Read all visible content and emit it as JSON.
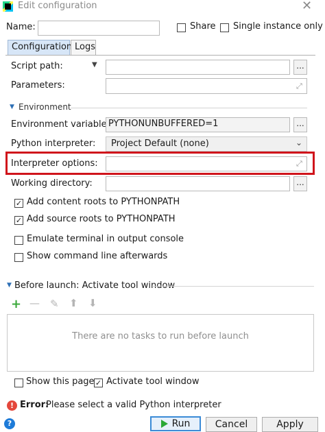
{
  "window": {
    "title": "Edit configuration"
  },
  "form": {
    "name_label": "Name:",
    "name_value": "",
    "share_label": "Share",
    "single_instance_label": "Single instance only"
  },
  "tabs": [
    {
      "label": "Configuration",
      "active": true
    },
    {
      "label": "Logs",
      "active": false
    }
  ],
  "config": {
    "script_path_label": "Script path:",
    "script_path_value": "",
    "parameters_label": "Parameters:",
    "parameters_value": "",
    "environment_header": "Environment",
    "env_vars_label": "Environment variables:",
    "env_vars_value": "PYTHONUNBUFFERED=1",
    "interpreter_label": "Python interpreter:",
    "interpreter_value": "Project Default (none)",
    "interpreter_options_label": "Interpreter options:",
    "interpreter_options_value": "",
    "working_dir_label": "Working directory:",
    "working_dir_value": "",
    "browse_label": "...",
    "checkboxes": [
      {
        "label": "Add content roots to PYTHONPATH",
        "checked": true
      },
      {
        "label": "Add source roots to PYTHONPATH",
        "checked": true
      },
      {
        "label": "Emulate terminal in output console",
        "checked": false
      },
      {
        "label": "Show command line afterwards",
        "checked": false
      }
    ]
  },
  "before_launch": {
    "header": "Before launch: Activate tool window",
    "empty_text": "There are no tasks to run before launch",
    "show_page_label": "Show this page",
    "show_page_checked": false,
    "activate_tool_label": "Activate tool window",
    "activate_tool_checked": true
  },
  "error": {
    "prefix": "Error:",
    "message": "Please select a valid Python interpreter"
  },
  "buttons": {
    "run": "Run",
    "cancel": "Cancel",
    "apply": "Apply"
  },
  "colors": {
    "highlight": "#d0141b",
    "error": "#e4473b",
    "run_arrow": "#2aa836",
    "primary_border": "#3a8ad6"
  }
}
